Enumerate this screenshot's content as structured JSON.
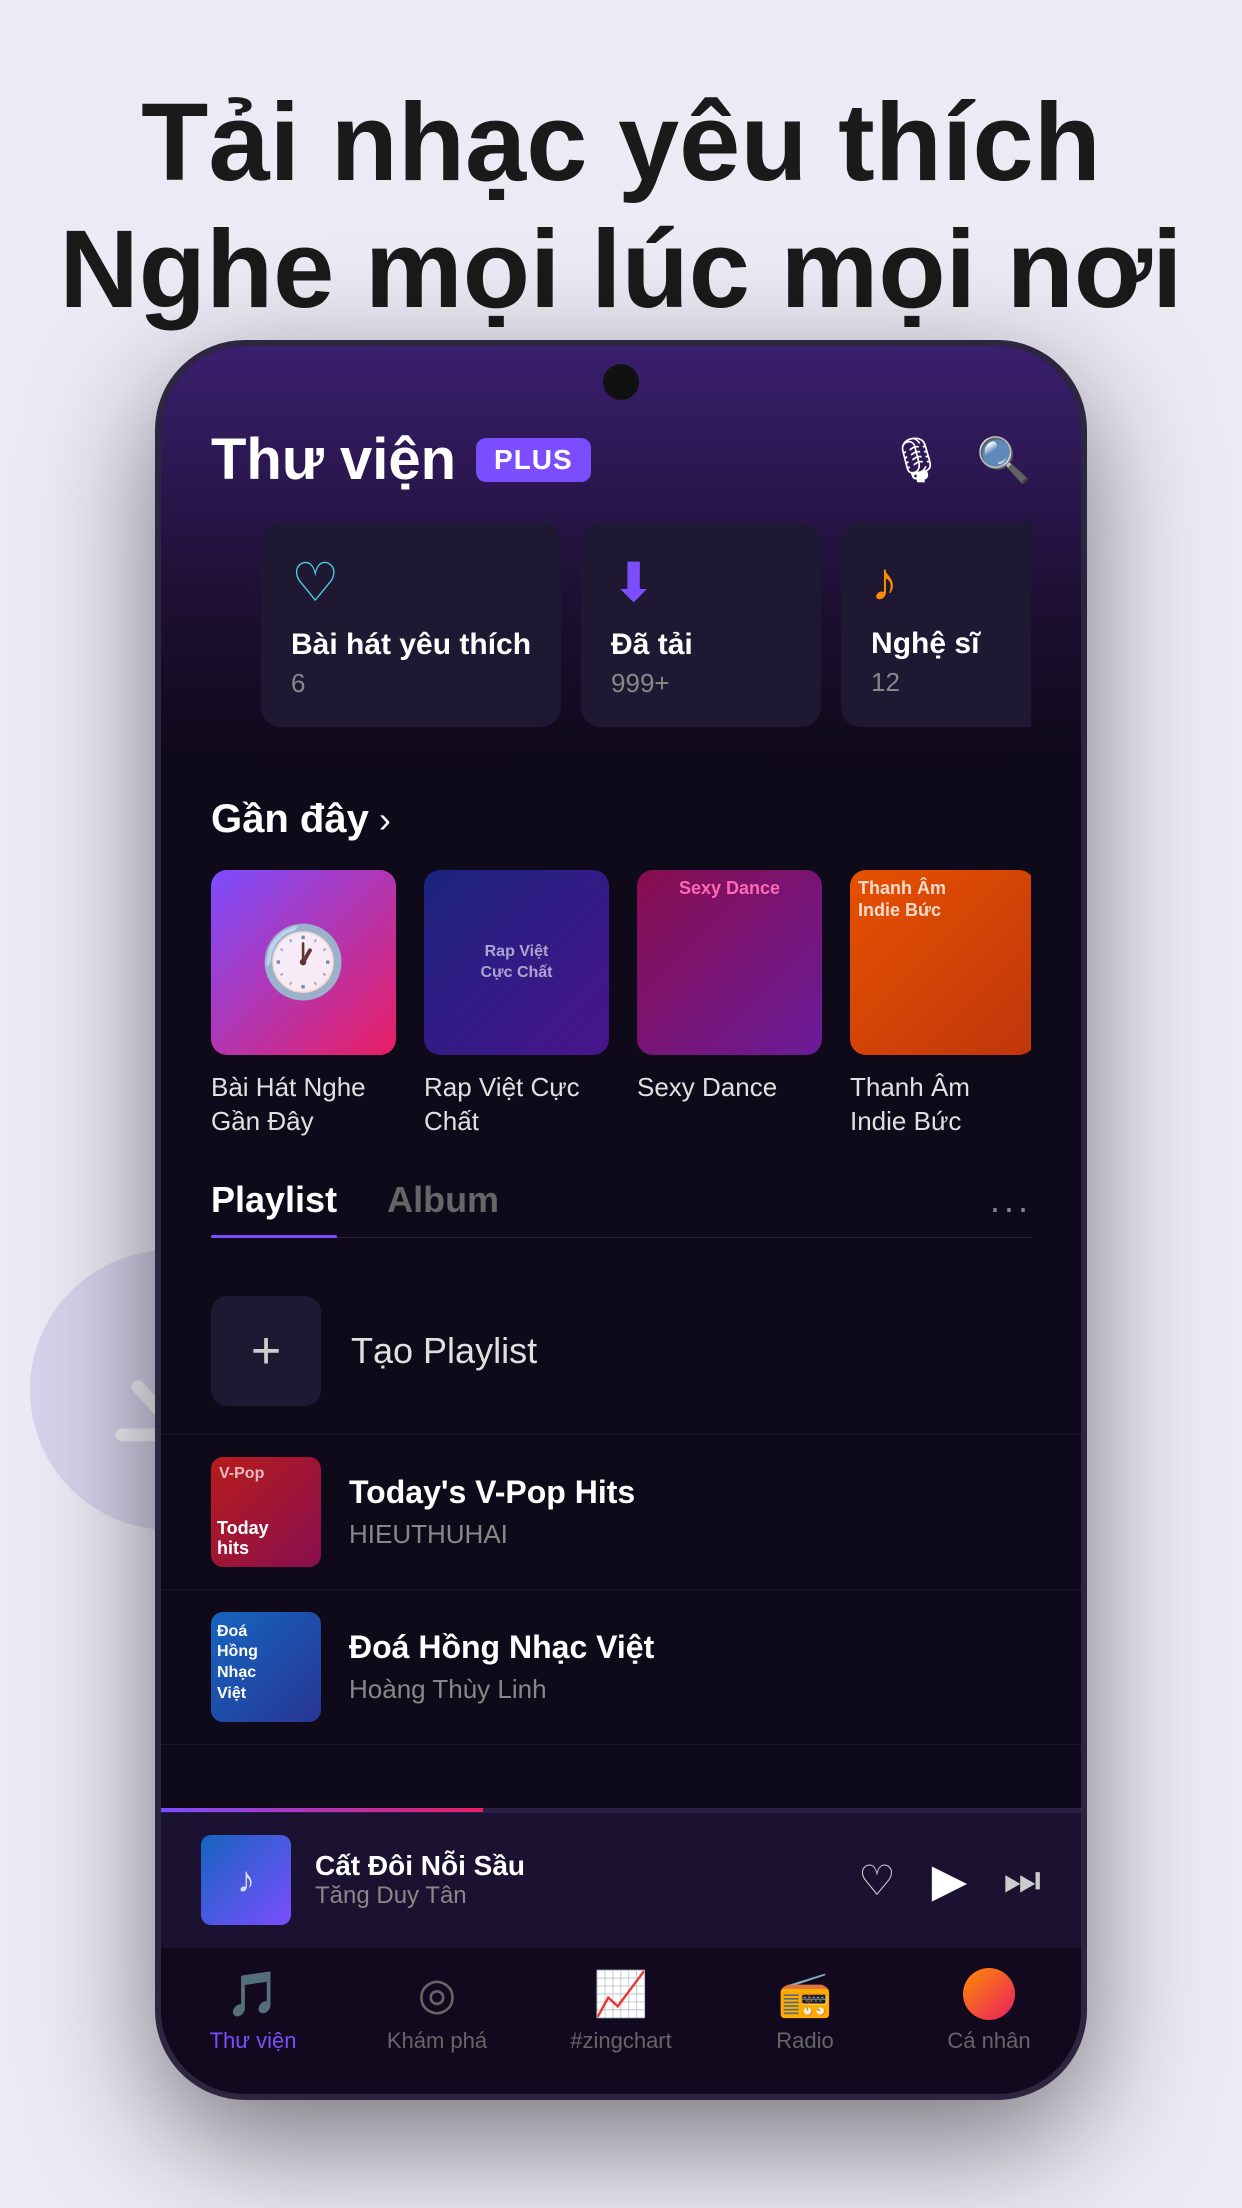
{
  "hero": {
    "line1": "Tải nhạc yêu thích",
    "line2": "Nghe mọi lúc mọi nơi"
  },
  "app": {
    "title": "Thư viện",
    "plus_badge": "PLUS"
  },
  "quick_cards": [
    {
      "id": "favorites",
      "icon_type": "heart",
      "title": "Bài hát yêu thích",
      "count": "6"
    },
    {
      "id": "downloaded",
      "icon_type": "download",
      "title": "Đã tải",
      "count": "999+"
    },
    {
      "id": "artists",
      "icon_type": "artist",
      "title": "Nghệ sĩ",
      "count": "12"
    }
  ],
  "recent_section": {
    "title": "Gần đây",
    "arrow": "›"
  },
  "recent_items": [
    {
      "id": "recent1",
      "type": "clock",
      "label": "Bài Hát Nghe\nGần Đây"
    },
    {
      "id": "recent2",
      "type": "rap",
      "label": "Rap Việt Cực\nChất",
      "overlay": "Rap Việt Cực Chất"
    },
    {
      "id": "recent3",
      "type": "dance",
      "label": "Sexy Dance",
      "overlay": "Sexy Dance"
    },
    {
      "id": "recent4",
      "type": "indie",
      "label": "Thanh Âm\nIndie Bức",
      "overlay": "Thanh Âm\nIndie Bức"
    }
  ],
  "tabs": {
    "playlist_label": "Playlist",
    "album_label": "Album",
    "more": "···",
    "active": "playlist"
  },
  "create_playlist": {
    "label": "Tạo Playlist"
  },
  "playlists": [
    {
      "id": "vpop",
      "name": "Today's V-Pop Hits",
      "author": "HIEUTHUHAI",
      "thumb_label": "V-Pop",
      "thumb_sub": "Today\nhits"
    },
    {
      "id": "doa",
      "name": "Đoá Hồng Nhạc Việt",
      "author": "Hoàng Thùy Linh",
      "thumb_label": "Đoá\nHồng\nNhạc\nViệt"
    }
  ],
  "now_playing": {
    "title": "Cất Đôi Nỗi Sầu",
    "artist": "Tăng Duy Tân"
  },
  "bottom_nav": [
    {
      "id": "library",
      "label": "Thư viện",
      "active": true
    },
    {
      "id": "explore",
      "label": "Khám phá",
      "active": false
    },
    {
      "id": "zingchart",
      "label": "#zingchart",
      "active": false
    },
    {
      "id": "radio",
      "label": "Radio",
      "active": false
    },
    {
      "id": "profile",
      "label": "Cá nhân",
      "active": false,
      "has_avatar": true
    }
  ]
}
